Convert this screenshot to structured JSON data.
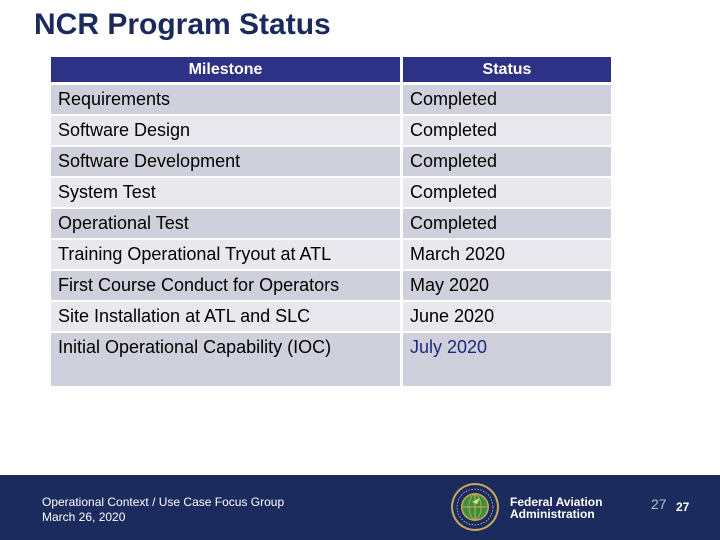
{
  "slide": {
    "title": "NCR Program Status"
  },
  "table": {
    "headers": [
      "Milestone",
      "Status"
    ],
    "rows": [
      {
        "milestone": "Requirements",
        "status": "Completed"
      },
      {
        "milestone": "Software Design",
        "status": "Completed"
      },
      {
        "milestone": "Software Development",
        "status": "Completed"
      },
      {
        "milestone": "System Test",
        "status": "Completed"
      },
      {
        "milestone": "Operational Test",
        "status": "Completed"
      },
      {
        "milestone": "Training Operational Tryout at ATL",
        "status": "March 2020"
      },
      {
        "milestone": "First Course Conduct for Operators",
        "status": "May 2020"
      },
      {
        "milestone": "Site Installation at ATL and SLC",
        "status": "June 2020"
      },
      {
        "milestone": "Initial Operational Capability (IOC)",
        "status": "July 2020"
      }
    ]
  },
  "footer": {
    "event": "Operational Context / Use Case Focus Group",
    "date": "March 26, 2020",
    "org_line1": "Federal Aviation",
    "org_line2": "Administration",
    "seal_icon": "faa-seal-icon",
    "page_number_placeholder": "27",
    "page_number": "27"
  },
  "colors": {
    "title": "#1b2a5c",
    "header_bg": "#2e3286",
    "row_dark": "#cfd0dc",
    "row_light": "#e8e8ee",
    "footer_bg": "#1c2b5e",
    "accent_text": "#1b2a7a"
  }
}
